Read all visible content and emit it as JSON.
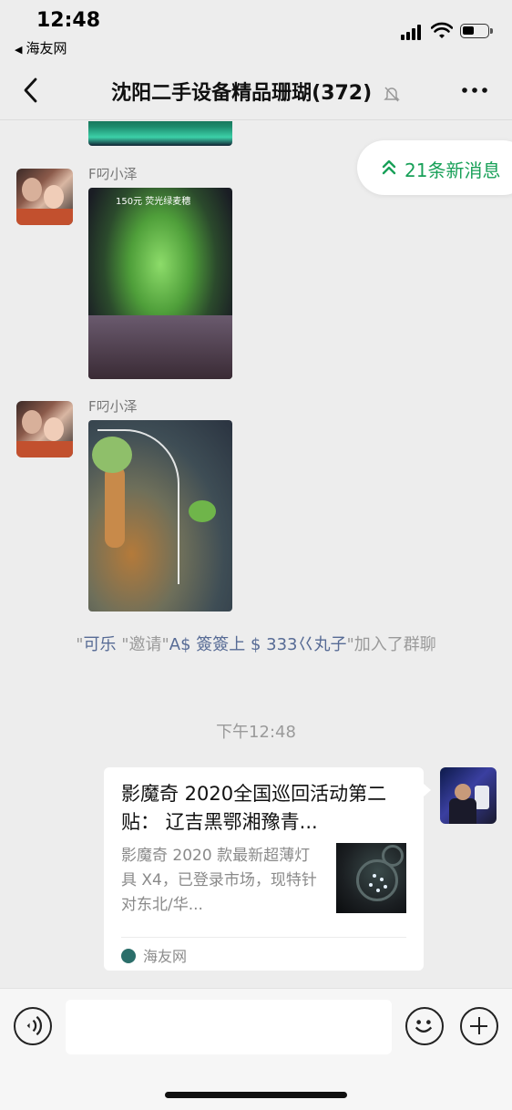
{
  "status_bar": {
    "time": "12:48",
    "back_app": "海友网",
    "icons": [
      "signal-icon",
      "wifi-icon",
      "battery-icon"
    ]
  },
  "nav": {
    "title": "沈阳二手设备精品珊瑚(372)",
    "icons": [
      "back-chevron-icon",
      "mute-bell-icon",
      "more-dots-icon"
    ]
  },
  "new_messages": {
    "label": "21条新消息",
    "accent": "#18a058"
  },
  "messages": [
    {
      "sender": "F叼小泽",
      "type": "image",
      "image_caption": "150元  荧光绿麦穗"
    },
    {
      "sender": "F叼小泽",
      "type": "image",
      "image_caption": ""
    }
  ],
  "system_message": {
    "quote_open": "\"",
    "user1": "可乐",
    "middle": " \"邀请\"",
    "user2": "A$ 簽簽上 $   333巜丸子",
    "suffix": "\"加入了群聊"
  },
  "timestamp": "下午12:48",
  "card": {
    "title": "影魔奇 2020全国巡回活动第二贴： 辽吉黑鄂湘豫青...",
    "description": "影魔奇 2020 款最新超薄灯具 X4，已登录市场，现特针对东北/华...",
    "source": "海友网"
  },
  "input_bar": {
    "placeholder": "",
    "icons": [
      "voice-icon",
      "emoji-icon",
      "plus-icon"
    ]
  }
}
